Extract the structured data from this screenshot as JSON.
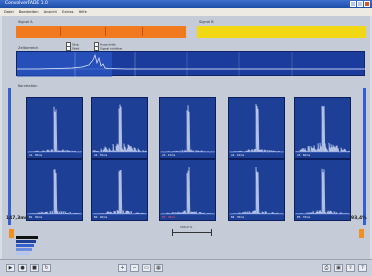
{
  "window": {
    "title": "ConvolverFADE 1.0"
  },
  "menu": [
    "Datei",
    "Bearbeiten",
    "Ansicht",
    "Extras",
    "Hilfe"
  ],
  "signals": {
    "a_label": "Signal A",
    "b_label": "Signal B",
    "a_color": "#f07a1d",
    "b_color": "#f2d812"
  },
  "overview": {
    "label": "Zeitbereich",
    "options": [
      "Stop",
      "Start",
      "Ausschnitt",
      "Signal sichtbar"
    ]
  },
  "grid": {
    "label": "Korrelation",
    "panels": [
      {
        "lbl": "A1 · 30ms",
        "red": false,
        "density": 0.25
      },
      {
        "lbl": "A2 · 55ms",
        "red": false,
        "density": 0.8
      },
      {
        "lbl": "A3 · 15ms",
        "red": false,
        "density": 0.2
      },
      {
        "lbl": "A4 · 10ms",
        "red": false,
        "density": 0.25
      },
      {
        "lbl": "A5 · 60ms",
        "red": false,
        "density": 0.85
      },
      {
        "lbl": "B1 · 30ms",
        "red": false,
        "density": 0.3
      },
      {
        "lbl": "B2 · 40ms",
        "red": false,
        "density": 0.35
      },
      {
        "lbl": "B3 · 28ms",
        "red": true,
        "density": 0.3
      },
      {
        "lbl": "B4 · 35ms",
        "red": false,
        "density": 0.3
      },
      {
        "lbl": "B5 · 33ms",
        "red": false,
        "density": 0.35
      }
    ]
  },
  "range": {
    "left": "147,3ms",
    "right": "93,4%",
    "slider_label": "100,0 %"
  },
  "legend_colors": [
    "#111111",
    "#1e3f96",
    "#345fd0",
    "#6a8de0",
    "#b4c6f0"
  ],
  "toolbar": {
    "left": [
      "play-icon",
      "record-icon",
      "stop-icon",
      "loop-icon"
    ],
    "middle": [
      "zoom-in-icon",
      "zoom-out-icon",
      "fit-icon",
      "grid-icon"
    ],
    "right": [
      "print-icon",
      "save-icon",
      "export-icon",
      "help-icon"
    ]
  }
}
